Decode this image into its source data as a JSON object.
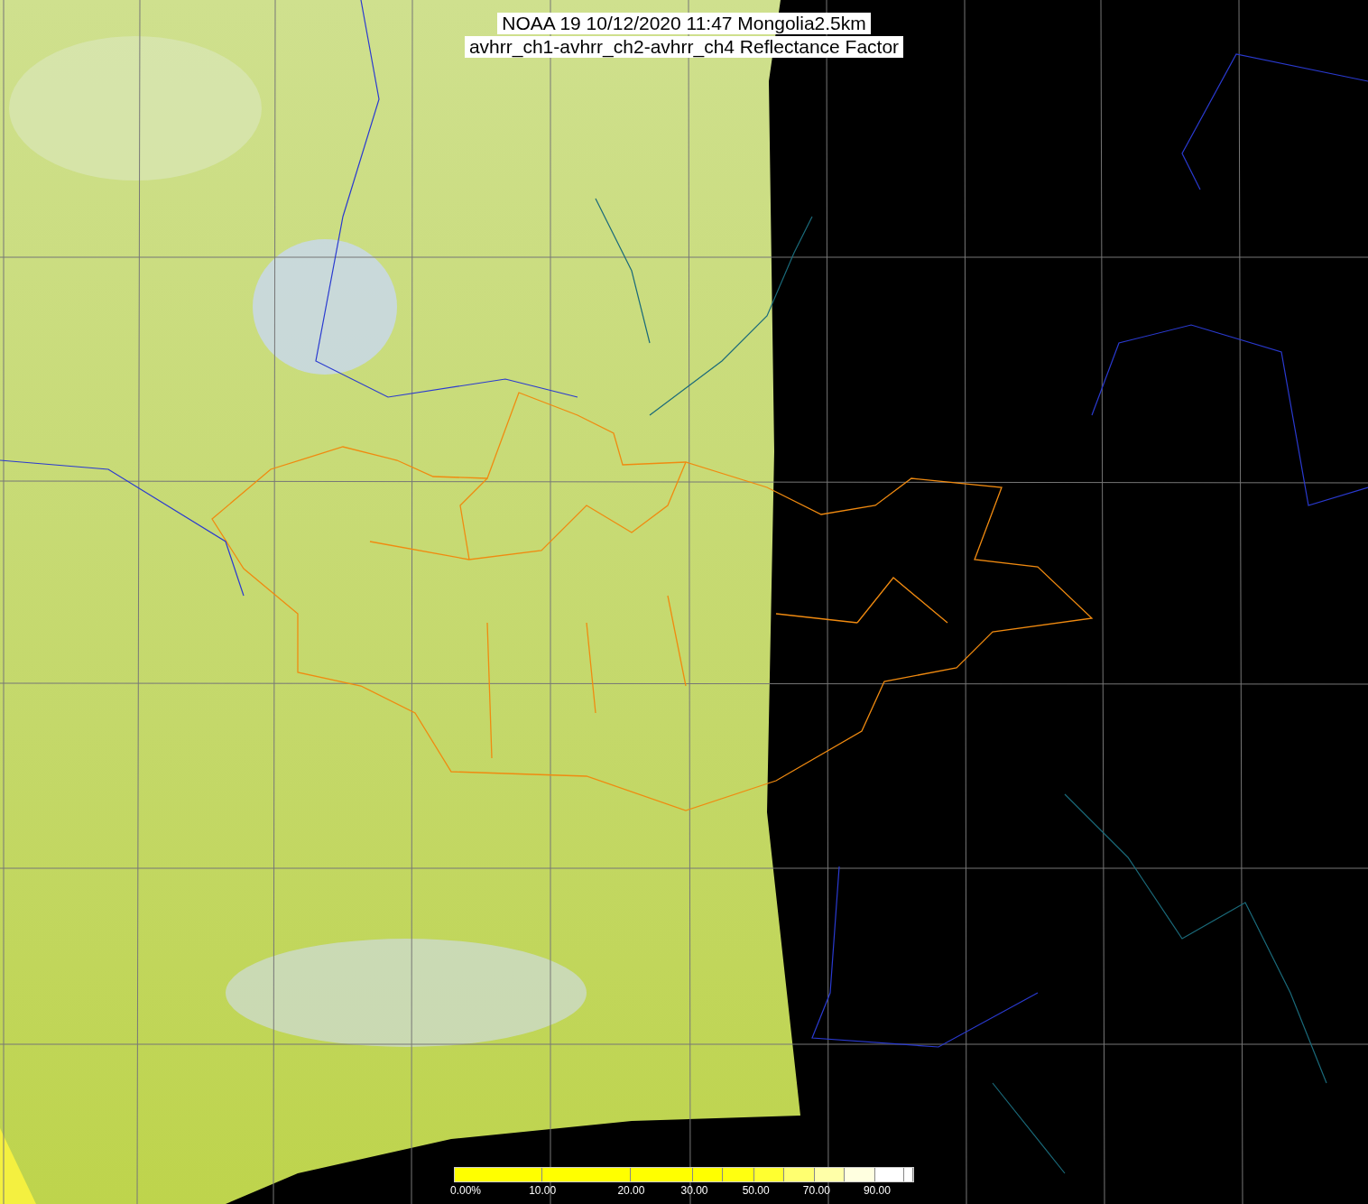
{
  "title": {
    "line_1": "NOAA 19 10/12/2020 11:47 Mongolia2.5km",
    "line_2": "avhrr_ch1-avhrr_ch2-avhrr_ch4 Reflectance Factor"
  },
  "colorbar": {
    "segments": [
      {
        "color": "#ffff00",
        "label": "0.00%"
      },
      {
        "color": "#ffff00",
        "label": "10.00"
      },
      {
        "color": "#ffff00",
        "label": "20.00"
      },
      {
        "color": "#ffff00",
        "label": "30.00"
      },
      {
        "color": "#ffff10"
      },
      {
        "color": "#ffff30",
        "label": "50.00"
      },
      {
        "color": "#ffff70"
      },
      {
        "color": "#ffffa8",
        "label": "70.00"
      },
      {
        "color": "#ffffe0"
      },
      {
        "color": "#ffffff",
        "label": "90.00"
      },
      {
        "color": "#ffffff"
      }
    ]
  }
}
